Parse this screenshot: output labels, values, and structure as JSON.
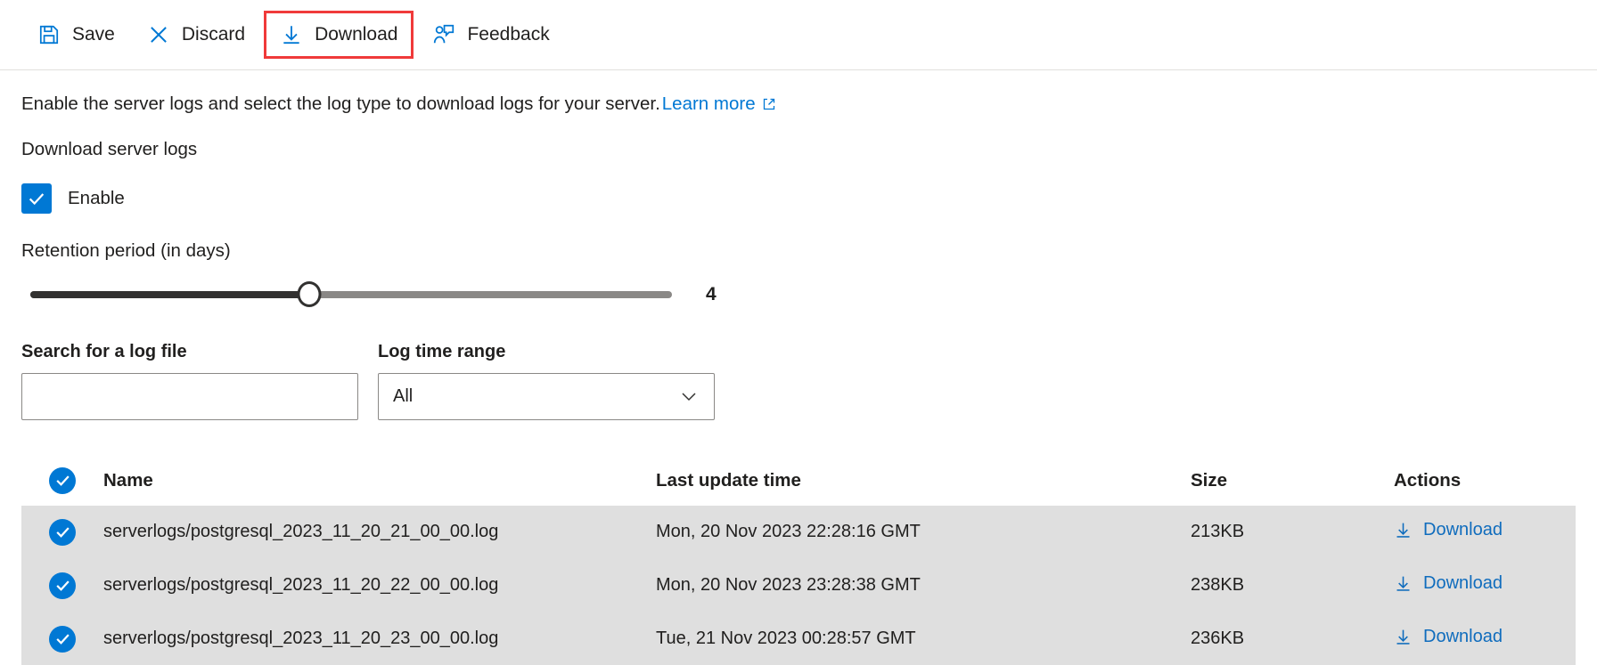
{
  "toolbar": {
    "items": [
      {
        "label": "Save",
        "icon": "save-icon",
        "highlighted": false
      },
      {
        "label": "Discard",
        "icon": "close-icon",
        "highlighted": false
      },
      {
        "label": "Download",
        "icon": "download-icon",
        "highlighted": true
      },
      {
        "label": "Feedback",
        "icon": "feedback-icon",
        "highlighted": false
      }
    ]
  },
  "description": {
    "text": "Enable the server logs and select the log type to download logs for your server.",
    "link_label": "Learn more",
    "link_icon": "external-link-icon"
  },
  "section": {
    "title": "Download server logs"
  },
  "enable": {
    "label": "Enable",
    "checked": true,
    "icon": "checkmark-icon"
  },
  "retention": {
    "label": "Retention period (in days)",
    "value": "4",
    "min": 1,
    "max": 7,
    "percent": 43.5
  },
  "filters": {
    "search": {
      "label": "Search for a log file",
      "value": "",
      "placeholder": ""
    },
    "time_range": {
      "label": "Log time range",
      "selected": "All",
      "chevron_icon": "chevron-down-icon"
    }
  },
  "table": {
    "select_all_checked": true,
    "headers": {
      "name": "Name",
      "last_update": "Last update time",
      "size": "Size",
      "actions": "Actions"
    },
    "download_label": "Download",
    "rows": [
      {
        "checked": true,
        "name": "serverlogs/postgresql_2023_11_20_21_00_00.log",
        "last_update": "Mon, 20 Nov 2023 22:28:16 GMT",
        "size": "213KB",
        "action": "Download"
      },
      {
        "checked": true,
        "name": "serverlogs/postgresql_2023_11_20_22_00_00.log",
        "last_update": "Mon, 20 Nov 2023 23:28:38 GMT",
        "size": "238KB",
        "action": "Download"
      },
      {
        "checked": true,
        "name": "serverlogs/postgresql_2023_11_20_23_00_00.log",
        "last_update": "Tue, 21 Nov 2023 00:28:57 GMT",
        "size": "236KB",
        "action": "Download"
      }
    ]
  },
  "colors": {
    "accent": "#0078d4",
    "highlight": "#f03a3a",
    "link": "#0f6cbd",
    "row_selected": "#dfdfdf",
    "slider_fill": "#323130",
    "slider_track": "#8a8886"
  }
}
